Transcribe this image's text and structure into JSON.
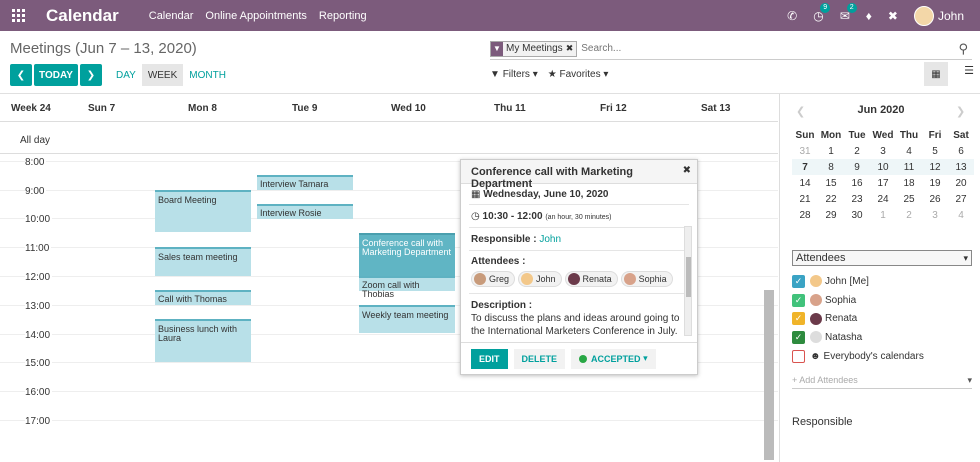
{
  "topbar": {
    "app_name": "Calendar",
    "menus": [
      "Calendar",
      "Online Appointments",
      "Reporting"
    ],
    "activity_badge": "9",
    "chat_badge": "2",
    "user_name": "John"
  },
  "control_panel": {
    "title": "Meetings (Jun 7 – 13, 2020)",
    "facet_label": "My Meetings",
    "search_placeholder": "Search...",
    "today_label": "TODAY",
    "scales": [
      "DAY",
      "WEEK",
      "MONTH"
    ],
    "active_scale": "WEEK",
    "filters_label": "Filters",
    "favorites_label": "Favorites"
  },
  "calendar": {
    "week_label": "Week 24",
    "days": [
      "Sun 7",
      "Mon 8",
      "Tue 9",
      "Wed 10",
      "Thu 11",
      "Fri 12",
      "Sat 13"
    ],
    "all_day_label": "All day",
    "hours": [
      "8:00",
      "9:00",
      "10:00",
      "11:00",
      "12:00",
      "13:00",
      "14:00",
      "15:00",
      "16:00",
      "17:00"
    ],
    "events": [
      {
        "title": "Board Meeting"
      },
      {
        "title": "Sales team meeting"
      },
      {
        "title": "Call with Thomas"
      },
      {
        "title": "Business lunch with Laura"
      },
      {
        "title": "Interview Tamara"
      },
      {
        "title": "Interview Rosie"
      },
      {
        "title": "Conference call with Marketing Department"
      },
      {
        "title": "Zoom call with Thobias"
      },
      {
        "title": "Weekly team meeting"
      }
    ]
  },
  "popover": {
    "title": "Conference call with Marketing Department",
    "date": "Wednesday, June 10, 2020",
    "time": "10:30 - 12:00",
    "duration": "(an hour, 30 minutes)",
    "responsible_label": "Responsible :",
    "responsible": "John",
    "attendees_label": "Attendees :",
    "attendees": [
      "Greg",
      "John",
      "Renata",
      "Sophia"
    ],
    "description_label": "Description :",
    "description": "To discuss the plans and ideas around going to the International Marketers Conference in July.",
    "edit_label": "EDIT",
    "delete_label": "DELETE",
    "status_label": "ACCEPTED"
  },
  "sidebar": {
    "month_label": "Jun 2020",
    "weekdays": [
      "Sun",
      "Mon",
      "Tue",
      "Wed",
      "Thu",
      "Fri",
      "Sat"
    ],
    "weeks": [
      [
        "31",
        "1",
        "2",
        "3",
        "4",
        "5",
        "6"
      ],
      [
        "7",
        "8",
        "9",
        "10",
        "11",
        "12",
        "13"
      ],
      [
        "14",
        "15",
        "16",
        "17",
        "18",
        "19",
        "20"
      ],
      [
        "21",
        "22",
        "23",
        "24",
        "25",
        "26",
        "27"
      ],
      [
        "28",
        "29",
        "30",
        "1",
        "2",
        "3",
        "4"
      ]
    ],
    "filter_select": "Attendees",
    "attendees": [
      {
        "name": "John [Me]",
        "color": "#3aa3c4"
      },
      {
        "name": "Sophia",
        "color": "#41c27b"
      },
      {
        "name": "Renata",
        "color": "#f0b429"
      },
      {
        "name": "Natasha",
        "color": "#2e8b3e"
      },
      {
        "name": "Everybody's calendars",
        "color": "#d9534f"
      }
    ],
    "add_placeholder": "+ Add Attendees",
    "responsible_label": "Responsible"
  }
}
